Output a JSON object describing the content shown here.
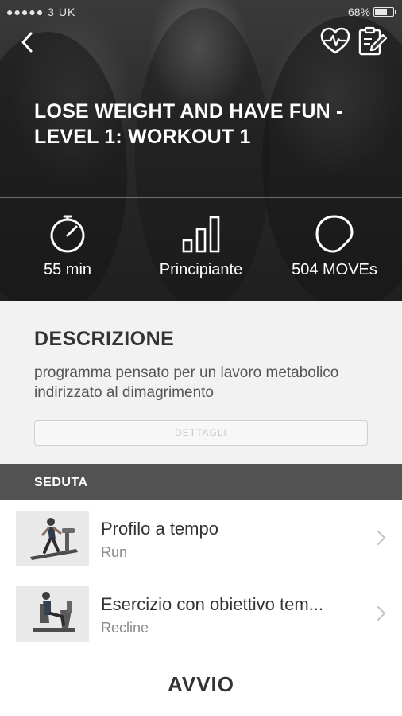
{
  "status_bar": {
    "carrier": "●●●●● 3 UK",
    "battery": "68%"
  },
  "header": {
    "title": "LOSE WEIGHT AND HAVE FUN - LEVEL 1: WORKOUT 1",
    "icons": [
      "back-chevron-icon",
      "heart-pulse-icon",
      "clipboard-edit-icon"
    ]
  },
  "stats": [
    {
      "icon": "stopwatch-icon",
      "label": "55 min"
    },
    {
      "icon": "level-bars-icon",
      "label": "Principiante"
    },
    {
      "icon": "moves-circle-icon",
      "label": "504 MOVEs"
    }
  ],
  "description": {
    "heading": "DESCRIZIONE",
    "text": "programma pensato per un lavoro metabolico indirizzato al dimagrimento",
    "details_button": "DETTAGLI"
  },
  "session": {
    "heading": "SEDUTA",
    "items": [
      {
        "title": "Profilo a tempo",
        "subtitle": "Run",
        "thumb": "treadmill-image"
      },
      {
        "title": "Esercizio con obiettivo tem...",
        "subtitle": "Recline",
        "thumb": "recumbent-bike-image"
      }
    ]
  },
  "start_button": "AVVIO",
  "colors": {
    "hero_dark": "#2a2a2a",
    "section_bar": "#525252",
    "description_bg": "#f2f2f2"
  }
}
